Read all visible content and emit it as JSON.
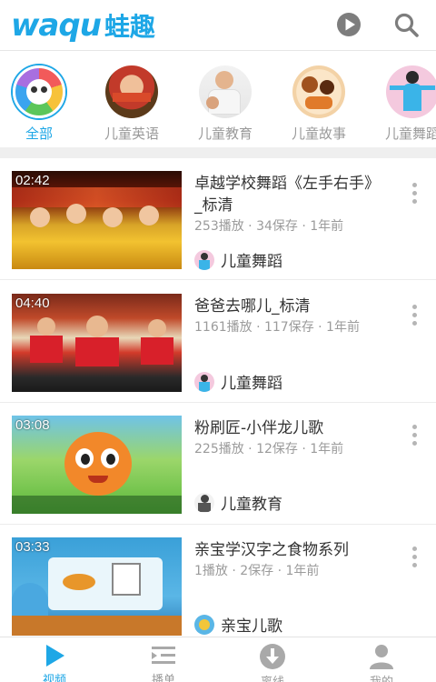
{
  "header": {
    "logo_en": "waqu",
    "logo_cn": "蛙趣",
    "play_icon": "play-circle-icon",
    "search_icon": "search-icon"
  },
  "categories": [
    {
      "label": "全部",
      "active": true
    },
    {
      "label": "儿童英语",
      "active": false
    },
    {
      "label": "儿童教育",
      "active": false
    },
    {
      "label": "儿童故事",
      "active": false
    },
    {
      "label": "儿童舞蹈",
      "active": false
    }
  ],
  "videos": [
    {
      "duration": "02:42",
      "title": "卓越学校舞蹈《左手右手》_标清",
      "meta": "253播放 · 34保存 · 1年前",
      "channel": "儿童舞蹈"
    },
    {
      "duration": "04:40",
      "title": "爸爸去哪儿_标清",
      "meta": "1161播放 · 117保存 · 1年前",
      "channel": "儿童舞蹈"
    },
    {
      "duration": "03:08",
      "title": "粉刷匠-小伴龙儿歌",
      "meta": "225播放 · 12保存 · 1年前",
      "channel": "儿童教育"
    },
    {
      "duration": "03:33",
      "title": "亲宝学汉字之食物系列",
      "meta": "1播放 · 2保存 · 1年前",
      "channel": "亲宝儿歌"
    }
  ],
  "nav": [
    {
      "label": "视频",
      "icon": "play-icon",
      "active": true
    },
    {
      "label": "播单",
      "icon": "playlist-icon",
      "active": false
    },
    {
      "label": "离线",
      "icon": "download-icon",
      "active": false
    },
    {
      "label": "我的",
      "icon": "user-icon",
      "active": false
    }
  ],
  "colors": {
    "accent": "#1ea7e6",
    "muted": "#9b9b9b"
  }
}
